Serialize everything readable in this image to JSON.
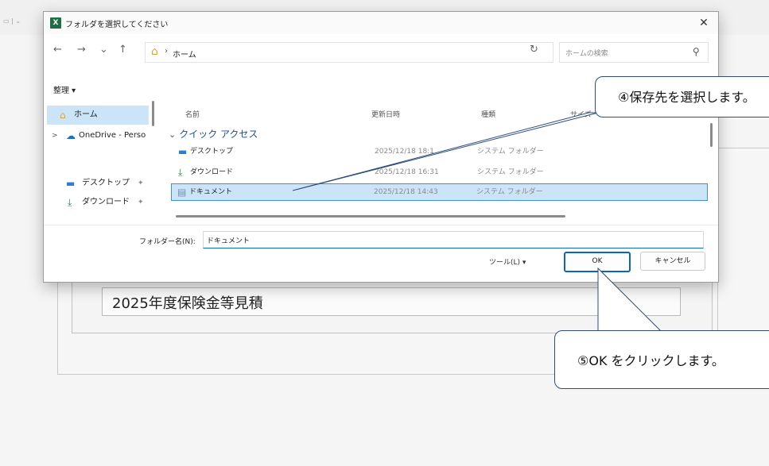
{
  "background": {
    "document_title": "2025年度保険金等見積"
  },
  "dialog": {
    "title": "フォルダを選択してください",
    "app_icon_label": "X",
    "nav": {
      "back": "←",
      "forward": "→",
      "dropdown": "⌄",
      "up": "↑"
    },
    "address": {
      "root": "ホーム",
      "separator": "›"
    },
    "search_placeholder": "ホームの検索",
    "organize_label": "整理 ▾",
    "sidebar": [
      {
        "label": "ホーム",
        "icon": "home-icon",
        "selected": true
      },
      {
        "label": "OneDrive - Perso",
        "icon": "cloud-icon",
        "expander": ">"
      },
      {
        "label": "デスクトップ",
        "icon": "desktop-icon",
        "pin": "📌"
      },
      {
        "label": "ダウンロード",
        "icon": "download-icon",
        "pin": "📌"
      }
    ],
    "columns": {
      "name": "名前",
      "modified": "更新日時",
      "type": "種類",
      "size": "サイズ"
    },
    "group_label": "クイック アクセス",
    "rows": [
      {
        "name": "デスクトップ",
        "date": "2025/12/18 18:1",
        "type": "システム フォルダー",
        "icon": "desktop-icon"
      },
      {
        "name": "ダウンロード",
        "date": "2025/12/18 16:31",
        "type": "システム フォルダー",
        "icon": "download-icon"
      },
      {
        "name": "ドキュメント",
        "date": "2025/12/18 14:43",
        "type": "システム フォルダー",
        "icon": "document-icon",
        "selected": true
      }
    ],
    "folder_name_label": "フォルダー名(N):",
    "folder_name_value": "ドキュメント",
    "tools_label": "ツール(L)  ▾",
    "ok_label": "OK",
    "cancel_label": "キャンセル"
  },
  "callouts": [
    {
      "text": "④保存先を選択します。"
    },
    {
      "text": "⑤OK をクリックします。"
    }
  ],
  "colors": {
    "selection": "#cce4f7",
    "accent": "#0a64c2",
    "callout_border": "#2e4d7b",
    "excel_green": "#1d7044"
  }
}
